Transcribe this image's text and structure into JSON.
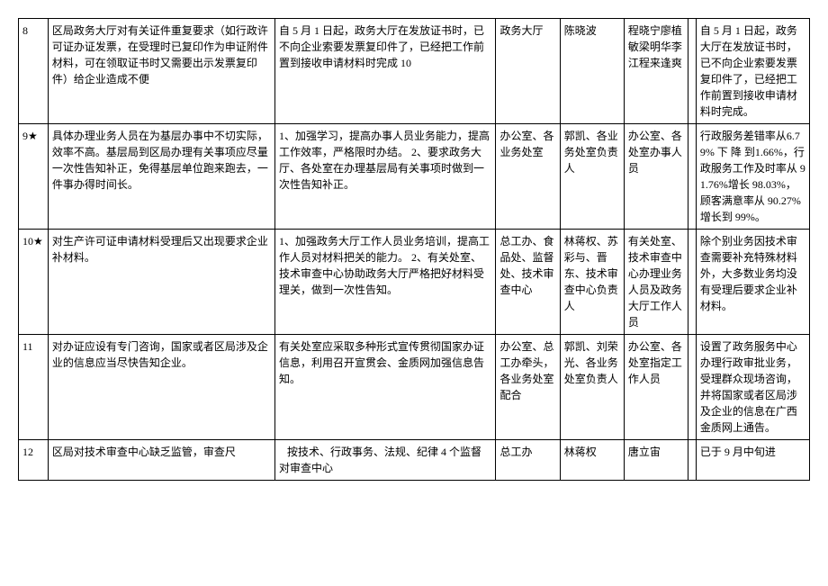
{
  "rows": [
    {
      "num": "8",
      "issue": "区局政务大厅对有关证件重复要求（如行政许可证办证发票，在受理时已复印作为申证附件材料，可在领取证书时又需要出示发票复印件）给企业造成不便",
      "measure": "自 5 月 1 日起，政务大厅在发放证书时，已不向企业索要发票复印件了，已经把工作前置到接收申请材料时完成 10",
      "dept1": "政务大厅",
      "dept2": "陈晓波",
      "dept3": "程晓宁廖植敏梁明华李江程来逢爽",
      "col7": "",
      "result": "自 5 月 1 日起，政务大厅在发放证书时，已不向企业索要发票复印件了，已经把工作前置到接收申请材料时完成。"
    },
    {
      "num": "9★",
      "issue": "具体办理业务人员在为基层办事中不切实际，效率不高。基层局到区局办理有关事项应尽量一次性告知补正，免得基层单位跑来跑去，一件事办得时间长。",
      "measure": "1、加强学习，提高办事人员业务能力，提高工作效率，严格限时办结。\n2、要求政务大厅、各处室在办理基层局有关事项时做到一次性告知补正。",
      "dept1": "办公室、各业务处室",
      "dept2": "郭凯、各业务处室负责人",
      "dept3": "办公室、各处室办事人员",
      "col7": "",
      "result": "行政服务差错率从6.79% 下 降 到1.66%，行政服务工作及时率从 91.76%增长 98.03%，顾客满意率从 90.27%增长到 99%。"
    },
    {
      "num": "10★",
      "issue": "对生产许可证申请材料受理后又出现要求企业补材料。",
      "measure": "1、加强政务大厅工作人员业务培训，提高工作人员对材料把关的能力。\n2、有关处室、技术审查中心协助政务大厅严格把好材料受理关，做到一次性告知。",
      "dept1": "总工办、食品处、监督处、技术审查中心",
      "dept2": "林蒋权、苏彩与、晋东、技术审查中心负责人",
      "dept3": "有关处室、技术审查中心办理业务人员及政务大厅工作人员",
      "col7": "",
      "result": "除个别业务因技术审查需要补充特殊材料外，大多数业务均没有受理后要求企业补材料。"
    },
    {
      "num": "11",
      "issue": "对办证应设有专门咨询，国家或者区局涉及企业的信息应当尽快告知企业。",
      "measure": "有关处室应采取多种形式宣传贯彻国家办证信息，利用召开宣贯会、金质网加强信息告知。",
      "dept1": "办公室、总工办牵头，各业务处室配合",
      "dept2": "郭凯、刘荣光、各业务处室负责人",
      "dept3": "办公室、各处室指定工作人员",
      "col7": "",
      "result": "设置了政务服务中心办理行政审批业务，受理群众现场咨询，并将国家或者区局涉及企业的信息在广西金质网上通告。"
    },
    {
      "num": "12",
      "issue": "区局对技术审查中心缺乏监管，审查尺",
      "measure": "   按技术、行政事务、法规、纪律 4 个监督对审查中心",
      "dept1": "总工办",
      "dept2": "林蒋权",
      "dept3": "唐立宙",
      "col7": "",
      "result": "已于 9 月中旬进"
    }
  ]
}
